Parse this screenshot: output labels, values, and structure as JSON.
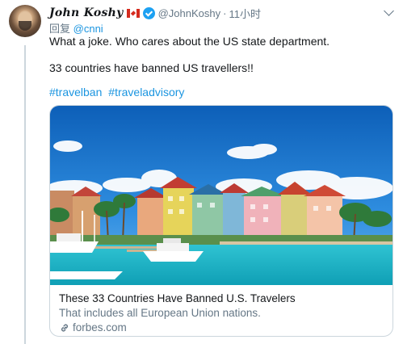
{
  "tweet": {
    "display_name": "John Koshy",
    "flag_icon": "canada-flag-icon",
    "verified_icon": "verified-badge-icon",
    "handle": "@JohnKoshy",
    "separator": "·",
    "time": "11小时",
    "reply_prefix": "回复",
    "reply_mention": "@cnni",
    "text_line_1": "What a joke. Who cares about the US state department.",
    "text_line_2": "33 countries have banned US travellers!!",
    "hashtags": [
      "#travelban",
      "#traveladvisory"
    ]
  },
  "card": {
    "title": "These 33 Countries Have Banned U.S. Travelers",
    "description": "That includes all European Union nations.",
    "domain": "forbes.com",
    "domain_icon": "link-icon"
  },
  "colors": {
    "link_blue": "#1b95e0",
    "verified_blue": "#1da1f2",
    "secondary_text": "#657786",
    "flag_red": "#d52b1e"
  }
}
